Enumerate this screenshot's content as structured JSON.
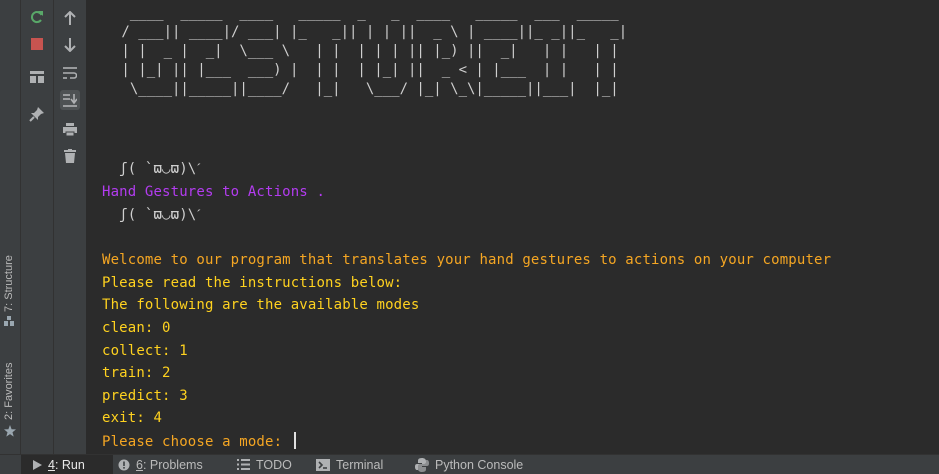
{
  "left_strip": {
    "structure_tab": "7: Structure",
    "favorites_tab": "2: Favorites"
  },
  "run_toolbar": {
    "buttons": [
      "rerun-icon",
      "stop-icon",
      "layout-icon",
      "pin-icon"
    ],
    "buttons2": [
      "up-arrow-icon",
      "down-arrow-icon",
      "soft-wrap-icon",
      "scroll-to-end-icon",
      "print-icon",
      "trash-icon"
    ]
  },
  "console": {
    "ascii_art": "  ____  _____  ____   _____  _   _  ____   _____  ___  _____\n / ___|| ____|/ ___| |_   _|| | | ||  _ \\ | ____||_ _||_   _|\n | |  _ |  _|  \\___ \\   | |  | | | || |_) ||  _|   | |   | |\n | |_| || |___  ___) |  | |  | |_| ||  _ < | |___  | |   | |\n  \\____||_____||____/   |_|   \\___/ |_| \\_\\|_____||___|  |_|",
    "kaomoji_1": "  ʃ( `ϖ◡ϖ)\\ˊ",
    "title": "Hand Gestures to Actions .",
    "kaomoji_2": "  ʃ( `ϖ◡ϖ)\\ˊ",
    "welcome": "Welcome to our program that translates your hand gestures to actions on your computer",
    "instructions": "Please read the instructions below:",
    "modes_header": "The following are the available modes",
    "mode_clean": "clean: 0",
    "mode_collect": "collect: 1",
    "mode_train": "train: 2",
    "mode_predict": "predict: 3",
    "mode_exit": "exit: 4",
    "prompt": "Please choose a mode: "
  },
  "bottom_bar": {
    "run_num": "4",
    "run_label": ": Run",
    "problems_num": "6",
    "problems_label": ": Problems",
    "todo": "TODO",
    "terminal": "Terminal",
    "python_console": "Python Console"
  },
  "colors": {
    "background": "#2b2b2b",
    "panel": "#3c3f41",
    "purple_text": "#b33cf0",
    "orange_text": "#f5a623",
    "yellow_text": "#ffd21f",
    "rerun_green": "#59a869",
    "stop_red": "#c75450"
  }
}
